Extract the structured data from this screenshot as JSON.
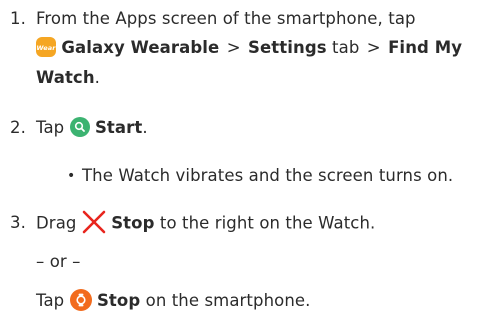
{
  "steps": [
    {
      "number": "1.",
      "line1_prefix": "From the Apps screen of the smartphone, tap",
      "app_icon_text": "Wear",
      "app_name": "Galaxy Wearable",
      "separator": ">",
      "settings_label": "Settings",
      "tab_word": "tab",
      "find_label_part1": "Find My",
      "find_label_part2": "Watch",
      "end_period": "."
    },
    {
      "number": "2.",
      "tap_word": "Tap",
      "start_label": "Start",
      "end_period": ".",
      "bullet": "The Watch vibrates and the screen turns on."
    },
    {
      "number": "3.",
      "drag_word": "Drag",
      "stop_label": "Stop",
      "rest": "to the right on the Watch.",
      "or_text": "– or –",
      "tap_word": "Tap",
      "rest2": "on the smartphone."
    }
  ],
  "colors": {
    "text": "#2b2b2b",
    "wear_icon": "#f5a623",
    "search_icon": "#3cb371",
    "close_icon": "#e8251d",
    "stop_icon": "#f26b1d"
  },
  "icons": [
    "galaxy-wearable-app-icon",
    "search-icon",
    "close-icon",
    "stop-watch-icon"
  ]
}
